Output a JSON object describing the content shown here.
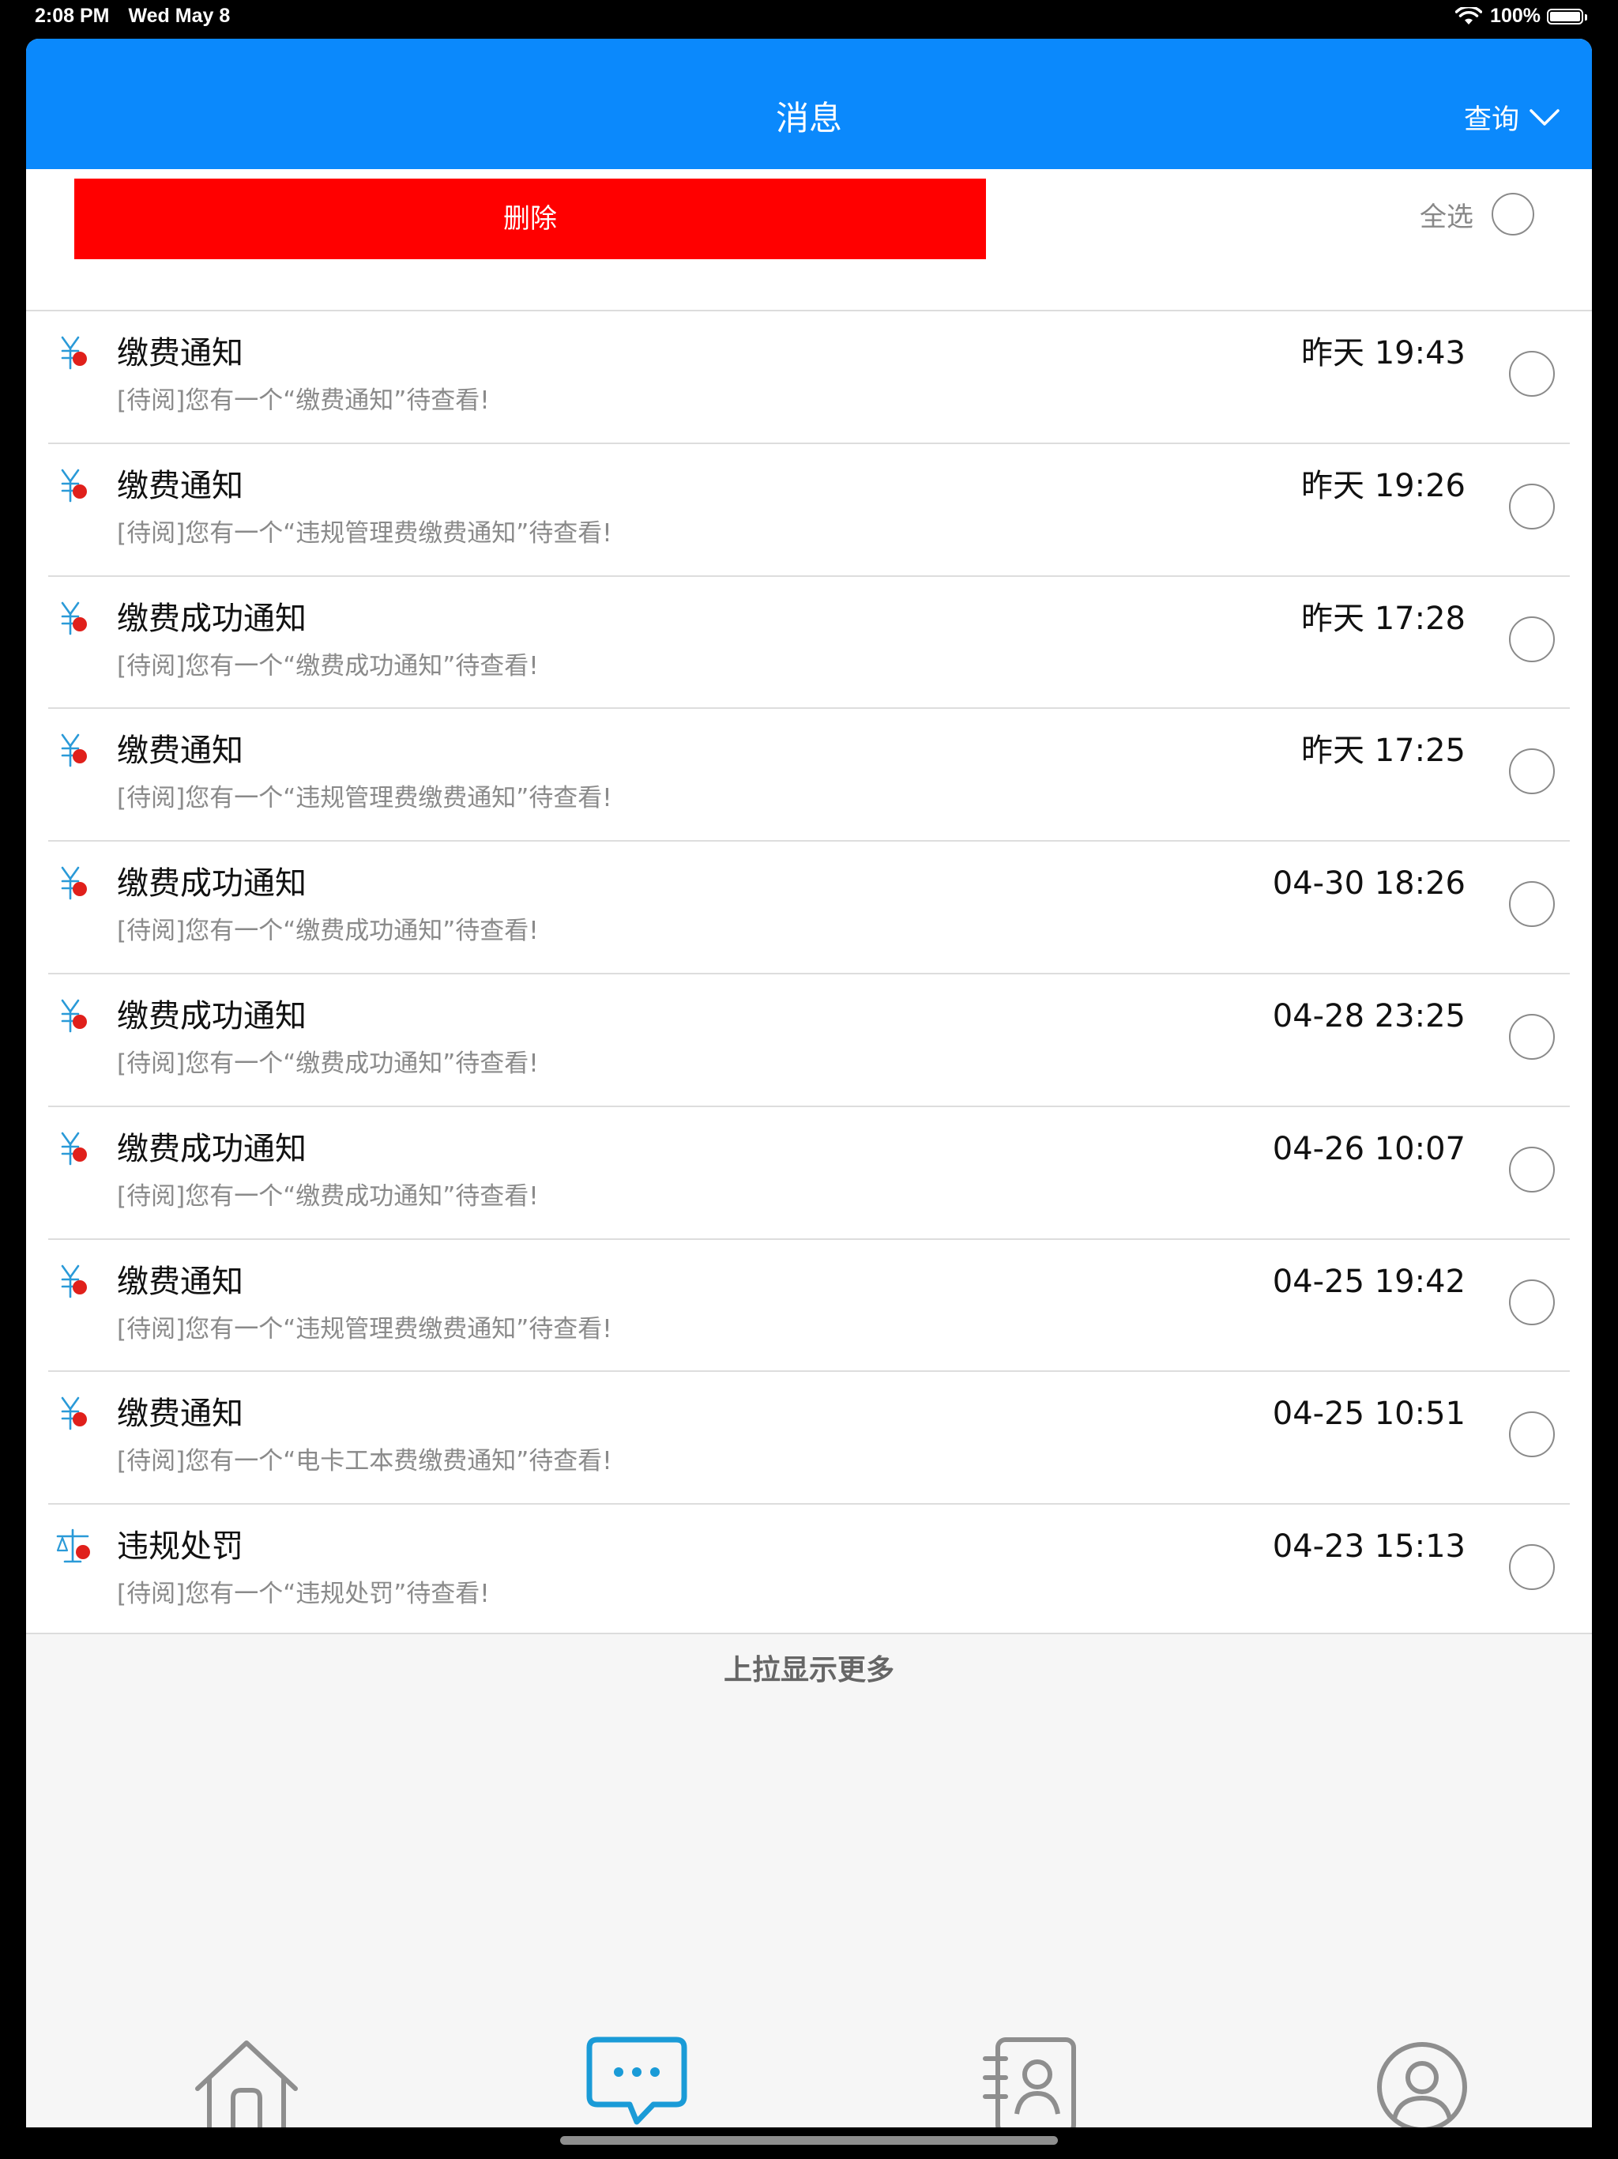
{
  "status_bar": {
    "time": "2:08 PM",
    "date": "Wed May 8",
    "battery": "100%"
  },
  "navbar": {
    "title": "消息",
    "query_label": "查询"
  },
  "toolbar": {
    "delete_label": "删除",
    "select_all_label": "全选"
  },
  "messages": [
    {
      "icon": "yuan-icon",
      "title": "缴费通知",
      "time": "昨天 19:43",
      "preview": "[待阅]您有一个“缴费通知”待查看!"
    },
    {
      "icon": "yuan-icon",
      "title": "缴费通知",
      "time": "昨天 19:26",
      "preview": "[待阅]您有一个“违规管理费缴费通知”待查看!"
    },
    {
      "icon": "yuan-icon",
      "title": "缴费成功通知",
      "time": "昨天 17:28",
      "preview": "[待阅]您有一个“缴费成功通知”待查看!"
    },
    {
      "icon": "yuan-icon",
      "title": "缴费通知",
      "time": "昨天 17:25",
      "preview": "[待阅]您有一个“违规管理费缴费通知”待查看!"
    },
    {
      "icon": "yuan-icon",
      "title": "缴费成功通知",
      "time": "04-30 18:26",
      "preview": "[待阅]您有一个“缴费成功通知”待查看!"
    },
    {
      "icon": "yuan-icon",
      "title": "缴费成功通知",
      "time": "04-28 23:25",
      "preview": "[待阅]您有一个“缴费成功通知”待查看!"
    },
    {
      "icon": "yuan-icon",
      "title": "缴费成功通知",
      "time": "04-26 10:07",
      "preview": "[待阅]您有一个“缴费成功通知”待查看!"
    },
    {
      "icon": "yuan-icon",
      "title": "缴费通知",
      "time": "04-25 19:42",
      "preview": "[待阅]您有一个“违规管理费缴费通知”待查看!"
    },
    {
      "icon": "yuan-icon",
      "title": "缴费通知",
      "time": "04-25 10:51",
      "preview": "[待阅]您有一个“电卡工本费缴费通知”待查看!"
    },
    {
      "icon": "scale-icon",
      "title": "违规处罚",
      "time": "04-23 15:13",
      "preview": "[待阅]您有一个“违规处罚”待查看!"
    }
  ],
  "load_more": "上拉显示更多",
  "tabbar": {
    "tabs": [
      {
        "icon": "home-icon"
      },
      {
        "icon": "message-icon"
      },
      {
        "icon": "contacts-icon"
      },
      {
        "icon": "profile-icon"
      }
    ]
  },
  "colors": {
    "navbar": "#0b89fc",
    "delete": "#ff0000",
    "unread_dot": "#e0201b",
    "icon_blue": "#2a9ad8",
    "tab_active": "#1a9bd7",
    "tab_inactive": "#8e8e8e"
  }
}
